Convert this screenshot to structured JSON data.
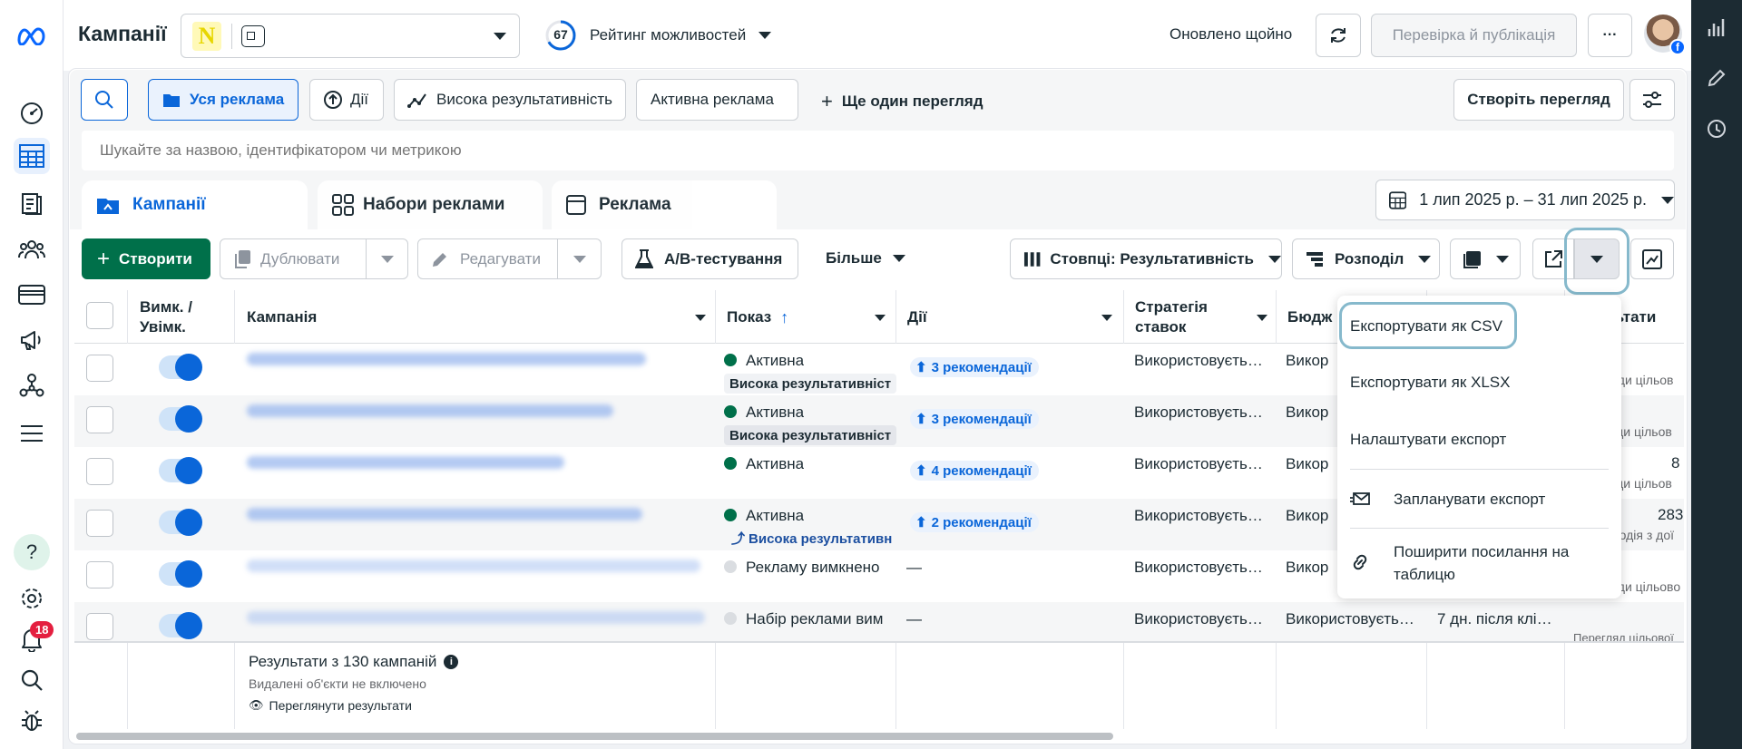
{
  "header": {
    "title": "Кампанії",
    "score": "67",
    "opportunity_label": "Рейтинг можливостей",
    "updated_label": "Оновлено щойно",
    "review_button": "Перевірка й публікація",
    "more_button": "···"
  },
  "views": {
    "all_ads": "Уся реклама",
    "actions": "Дії",
    "high_perf": "Висока результативність",
    "active_ads": "Активна реклама",
    "add_view": "Ще один перегляд",
    "create_view": "Створіть перегляд"
  },
  "search": {
    "placeholder": "Шукайте за назвою, ідентифікатором чи метрикою"
  },
  "tabs": [
    {
      "label": "Кампанії"
    },
    {
      "label": "Набори реклами"
    },
    {
      "label": "Реклама"
    }
  ],
  "date_range": "1 лип 2025 р. – 31 лип 2025 р.",
  "toolbar": {
    "create": "Створити",
    "duplicate": "Дублювати",
    "edit": "Редагувати",
    "ab_test": "A/B-тестування",
    "more": "Більше",
    "columns": "Стовпці: Результативність",
    "breakdown": "Розподіл"
  },
  "columns": {
    "onoff": "Вимк. / Увімк.",
    "campaign": "Кампанія",
    "delivery": "Показ",
    "actions": "Дії",
    "bid_strategy": "Стратегія ставок",
    "budget": "Бюдж",
    "results": "льтати"
  },
  "rows": [
    {
      "delivery": "Активна",
      "sub": "Висока результативніст",
      "rec": "3 рекомендації",
      "bid": "Використовуєть…",
      "budget": "Викор",
      "res_main": "",
      "res_sub": "ади цільов"
    },
    {
      "delivery": "Активна",
      "sub": "Висока результативніст",
      "rec": "3 рекомендації",
      "bid": "Використовуєть…",
      "budget": "Викор",
      "res_main": "",
      "res_sub": "зди цільов"
    },
    {
      "delivery": "Активна",
      "sub": "",
      "rec": "4 рекомендації",
      "bid": "Використовуєть…",
      "budget": "Викор",
      "res_main": "8",
      "res_sub": "зди цільов"
    },
    {
      "delivery": "Активна",
      "sub": "Висока результативн",
      "rec": "2 рекомендації",
      "bid": "Використовуєть…",
      "budget": "Викор",
      "res_main": "283",
      "res_sub": "модія з дої"
    },
    {
      "delivery": "Рекламу вимкнено",
      "sub": "",
      "rec": "—",
      "bid": "Використовуєть…",
      "budget": "Викор",
      "res_main": "",
      "res_sub": "ади цільово"
    },
    {
      "delivery": "Набір реклами вим",
      "sub": "",
      "rec": "—",
      "bid": "Використовуєть…",
      "budget": "Використовуєть…",
      "extra": "7 дн. після клі…",
      "res_main": "",
      "res_sub": "Перегляд цільової"
    }
  ],
  "footer": {
    "results": "Результати з 130 кампаній",
    "deleted": "Видалені об'єкти не включено",
    "view_results": "Переглянути результати"
  },
  "export_menu": {
    "csv": "Експортувати як CSV",
    "xlsx": "Експортувати як XLSX",
    "configure": "Налаштувати експорт",
    "schedule": "Запланувати експорт",
    "share": "Поширити посилання на таблицю"
  },
  "notifications_count": "18",
  "colors": {
    "brand": "#0866ff",
    "create_green": "#00704a",
    "active_green": "#00704a",
    "link_blue": "#0a66d9",
    "highlight": "#86b9cc",
    "notif_red": "#e41e3f"
  }
}
